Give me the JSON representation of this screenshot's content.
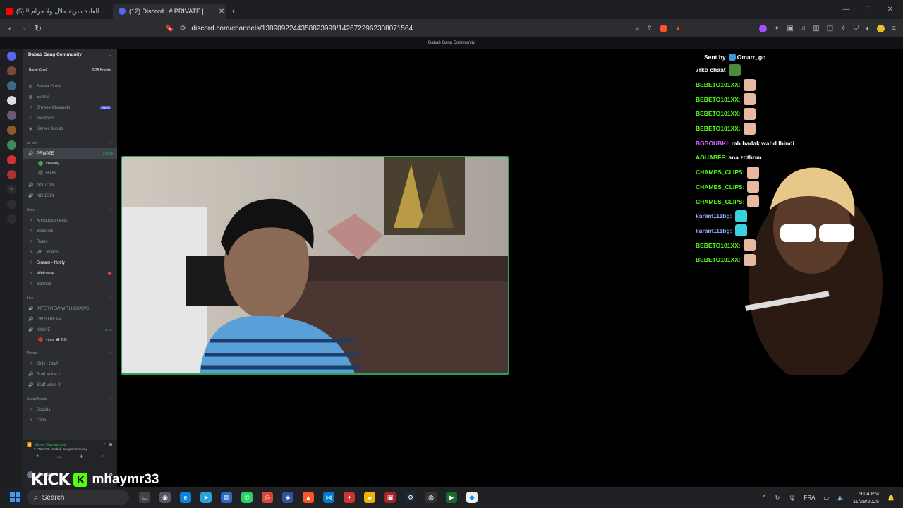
{
  "browser": {
    "tabs": [
      {
        "title": "العادة سرية حلال ولا حرام !! (5)",
        "active": false
      },
      {
        "title": "(12) Discord | # PRIVATE | ...",
        "active": true
      }
    ],
    "new_tab": "+",
    "url": "discord.com/channels/1389092244358823999/1426722962308071564"
  },
  "discord": {
    "window_title": "Dabab Gang Community",
    "server_name": "Dabab Gang Community",
    "boost_goal": "Boost Goal",
    "boost_count": "0/28 Boosts",
    "nav": [
      {
        "label": "Server Guide",
        "icon": "book-icon"
      },
      {
        "label": "Events",
        "icon": "calendar-icon"
      },
      {
        "label": "Browse Channels",
        "icon": "hash-icon",
        "badge": "NEW"
      },
      {
        "label": "Members",
        "icon": "members-icon"
      },
      {
        "label": "Server Boosts",
        "icon": "boost-icon"
      }
    ],
    "cat_join": "ne join",
    "voice_private": "PRIVATE",
    "voice_private_time": "1:43:39",
    "voice_users": [
      "chalaby",
      "HILAL"
    ],
    "no_join": [
      "NO JOIN",
      "NO JOIN"
    ],
    "cat_infos": "Infos",
    "info_channels": [
      "Announcements",
      "Boosters",
      "Rules",
      "ytb · videos",
      "Stream - Notify",
      "Welcome",
      "Banned"
    ],
    "cat_live": "Live",
    "live_channels": [
      "INTERVIEW WITH CHAWS",
      "ON STREAM",
      "MOVIE"
    ],
    "movie_time": "57:37",
    "live_user": "viper 🪐 BG",
    "cat_private": "Private",
    "private_channels": [
      "Only - Staff",
      "Staff Voice 1",
      "Staff Voice 2"
    ],
    "cat_social": "Social Media",
    "social_channels": [
      "Socials",
      "Clips"
    ],
    "voice_status": "Video Connected",
    "voice_location": "# PRIVATE / Dabab Gang Community",
    "username": "chalaby"
  },
  "stream_overlay": {
    "sent_by_label": "Sent by",
    "sent_by_user": "Omarr_go",
    "messages": [
      {
        "user": "7rko chaat",
        "text": "",
        "color": "#ffffff"
      },
      {
        "user": "BEBETO101XX:",
        "text": "",
        "color": "#53fc18"
      },
      {
        "user": "BEBETO101XX:",
        "text": "",
        "color": "#53fc18"
      },
      {
        "user": "BEBETO101XX:",
        "text": "",
        "color": "#53fc18"
      },
      {
        "user": "BEBETO101XX:",
        "text": "",
        "color": "#53fc18"
      },
      {
        "user": "BGSOUBKI:",
        "text": " rah hadak wahd lhindi",
        "color": "#d86bff"
      },
      {
        "user": "AOUABFF:",
        "text": " ana zdthom",
        "color": "#53fc18"
      },
      {
        "user": "CHAMES_CLIPS:",
        "text": "",
        "color": "#53fc18"
      },
      {
        "user": "CHAMES_CLIPS:",
        "text": "",
        "color": "#53fc18"
      },
      {
        "user": "CHAMES_CLIPS:",
        "text": "",
        "color": "#53fc18"
      },
      {
        "user": "karam111bg:",
        "text": "",
        "color": "#9aa9ff"
      },
      {
        "user": "karam111bg:",
        "text": "",
        "color": "#9aa9ff"
      },
      {
        "user": "BEBETO101XX:",
        "text": "",
        "color": "#53fc18"
      },
      {
        "user": "BEBETO101XX:",
        "text": "",
        "color": "#53fc18"
      }
    ],
    "kick_logo": "KICK",
    "kick_handle": "mhaymr33"
  },
  "taskbar": {
    "search_placeholder": "Search",
    "language": "FRA",
    "time": "9:04 PM",
    "date": "11/28/2025"
  },
  "colors": {
    "accent": "#5865f2",
    "speaking": "#23a55a",
    "kick_green": "#53fc18",
    "danger": "#f23f43"
  }
}
